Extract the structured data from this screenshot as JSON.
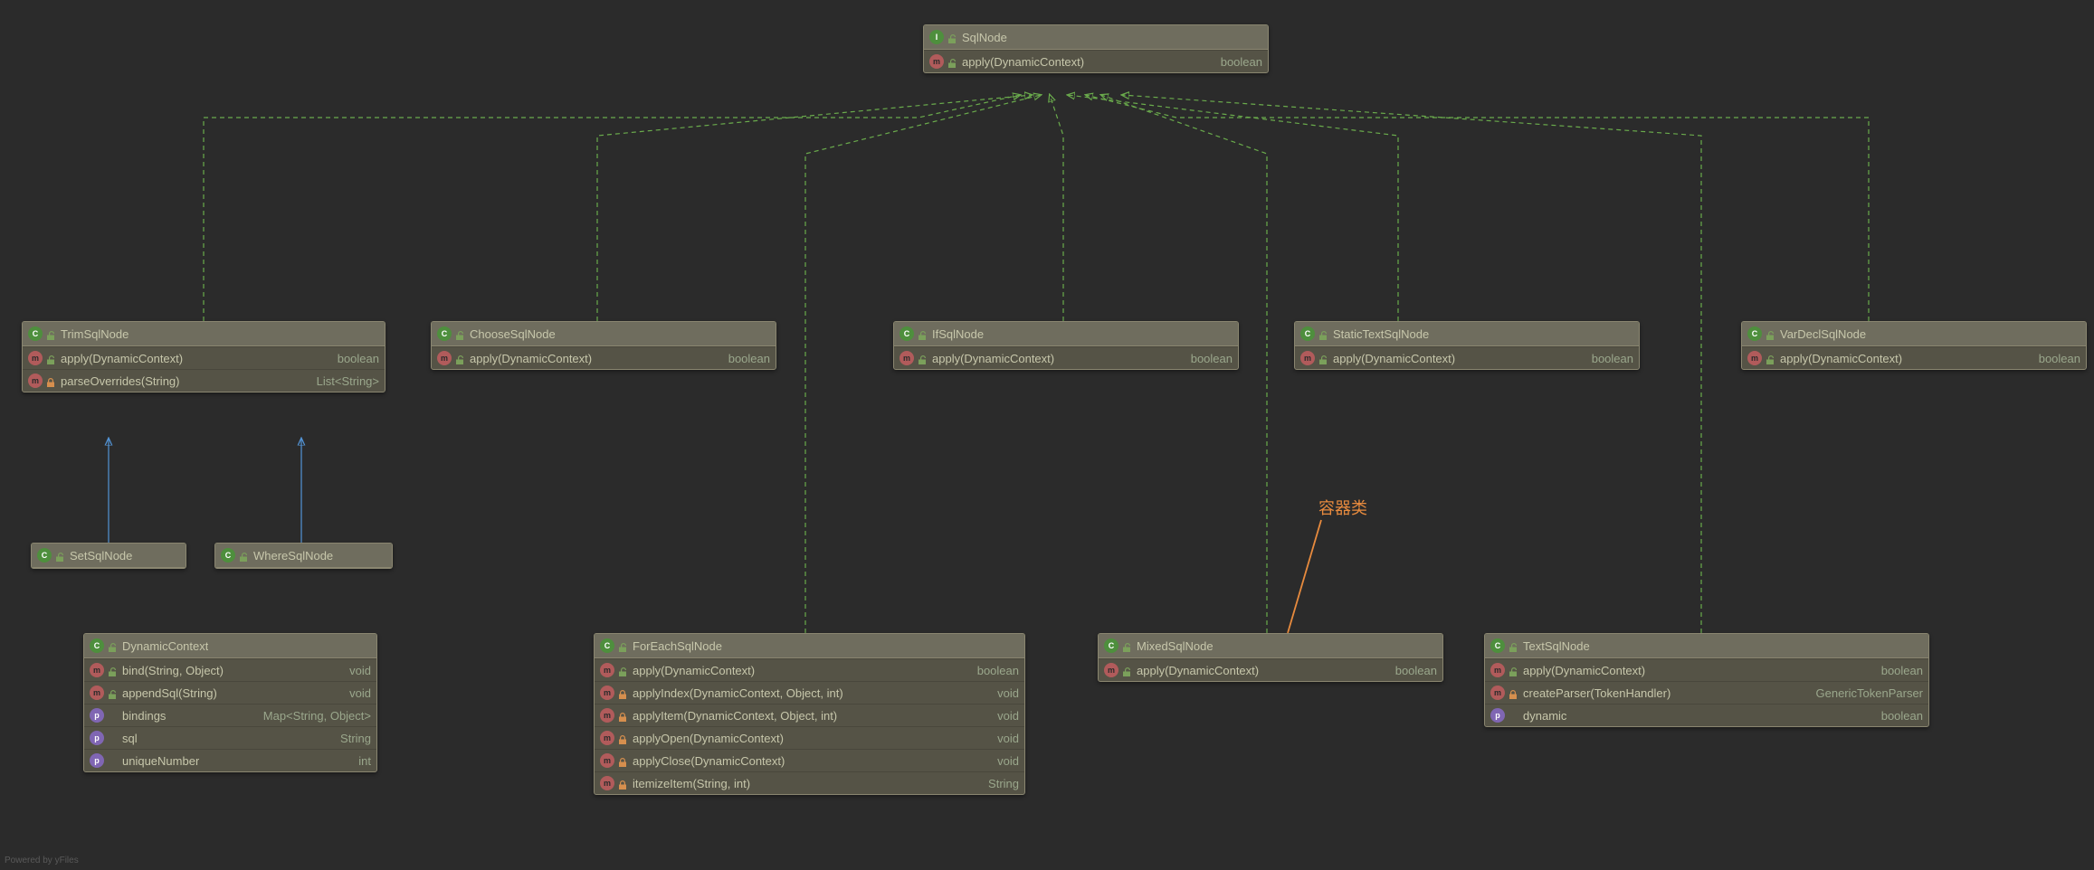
{
  "annotation": "容器类",
  "footer": "Powered by yFiles",
  "nodes": {
    "SqlNode": {
      "kind": "I",
      "title": "SqlNode",
      "rows": [
        {
          "ic": "m",
          "mod": "open",
          "name": "apply(DynamicContext)",
          "type": "boolean"
        }
      ]
    },
    "TrimSqlNode": {
      "kind": "C",
      "title": "TrimSqlNode",
      "rows": [
        {
          "ic": "m",
          "mod": "open",
          "name": "apply(DynamicContext)",
          "type": "boolean"
        },
        {
          "ic": "m",
          "mod": "lock",
          "name": "parseOverrides(String)",
          "type": "List<String>"
        }
      ]
    },
    "ChooseSqlNode": {
      "kind": "C",
      "title": "ChooseSqlNode",
      "rows": [
        {
          "ic": "m",
          "mod": "open",
          "name": "apply(DynamicContext)",
          "type": "boolean"
        }
      ]
    },
    "IfSqlNode": {
      "kind": "C",
      "title": "IfSqlNode",
      "rows": [
        {
          "ic": "m",
          "mod": "open",
          "name": "apply(DynamicContext)",
          "type": "boolean"
        }
      ]
    },
    "StaticTextSqlNode": {
      "kind": "C",
      "title": "StaticTextSqlNode",
      "rows": [
        {
          "ic": "m",
          "mod": "open",
          "name": "apply(DynamicContext)",
          "type": "boolean"
        }
      ]
    },
    "VarDeclSqlNode": {
      "kind": "C",
      "title": "VarDeclSqlNode",
      "rows": [
        {
          "ic": "m",
          "mod": "open",
          "name": "apply(DynamicContext)",
          "type": "boolean"
        }
      ]
    },
    "SetSqlNode": {
      "kind": "C",
      "title": "SetSqlNode",
      "rows": []
    },
    "WhereSqlNode": {
      "kind": "C",
      "title": "WhereSqlNode",
      "rows": []
    },
    "DynamicContext": {
      "kind": "C",
      "title": "DynamicContext",
      "rows": [
        {
          "ic": "m",
          "mod": "open",
          "name": "bind(String, Object)",
          "type": "void"
        },
        {
          "ic": "m",
          "mod": "open",
          "name": "appendSql(String)",
          "type": "void"
        },
        {
          "ic": "p",
          "mod": "",
          "name": "bindings",
          "type": "Map<String, Object>"
        },
        {
          "ic": "p",
          "mod": "",
          "name": "sql",
          "type": "String"
        },
        {
          "ic": "p",
          "mod": "",
          "name": "uniqueNumber",
          "type": "int"
        }
      ]
    },
    "ForEachSqlNode": {
      "kind": "C",
      "title": "ForEachSqlNode",
      "rows": [
        {
          "ic": "m",
          "mod": "open",
          "name": "apply(DynamicContext)",
          "type": "boolean"
        },
        {
          "ic": "m",
          "mod": "lock",
          "name": "applyIndex(DynamicContext, Object, int)",
          "type": "void"
        },
        {
          "ic": "m",
          "mod": "lock",
          "name": "applyItem(DynamicContext, Object, int)",
          "type": "void"
        },
        {
          "ic": "m",
          "mod": "lock",
          "name": "applyOpen(DynamicContext)",
          "type": "void"
        },
        {
          "ic": "m",
          "mod": "lock",
          "name": "applyClose(DynamicContext)",
          "type": "void"
        },
        {
          "ic": "m",
          "mod": "lock",
          "name": "itemizeItem(String, int)",
          "type": "String"
        }
      ]
    },
    "MixedSqlNode": {
      "kind": "C",
      "title": "MixedSqlNode",
      "rows": [
        {
          "ic": "m",
          "mod": "open",
          "name": "apply(DynamicContext)",
          "type": "boolean"
        }
      ]
    },
    "TextSqlNode": {
      "kind": "C",
      "title": "TextSqlNode",
      "rows": [
        {
          "ic": "m",
          "mod": "open",
          "name": "apply(DynamicContext)",
          "type": "boolean"
        },
        {
          "ic": "m",
          "mod": "lock",
          "name": "createParser(TokenHandler)",
          "type": "GenericTokenParser"
        },
        {
          "ic": "p",
          "mod": "",
          "name": "dynamic",
          "type": "boolean"
        }
      ]
    }
  }
}
